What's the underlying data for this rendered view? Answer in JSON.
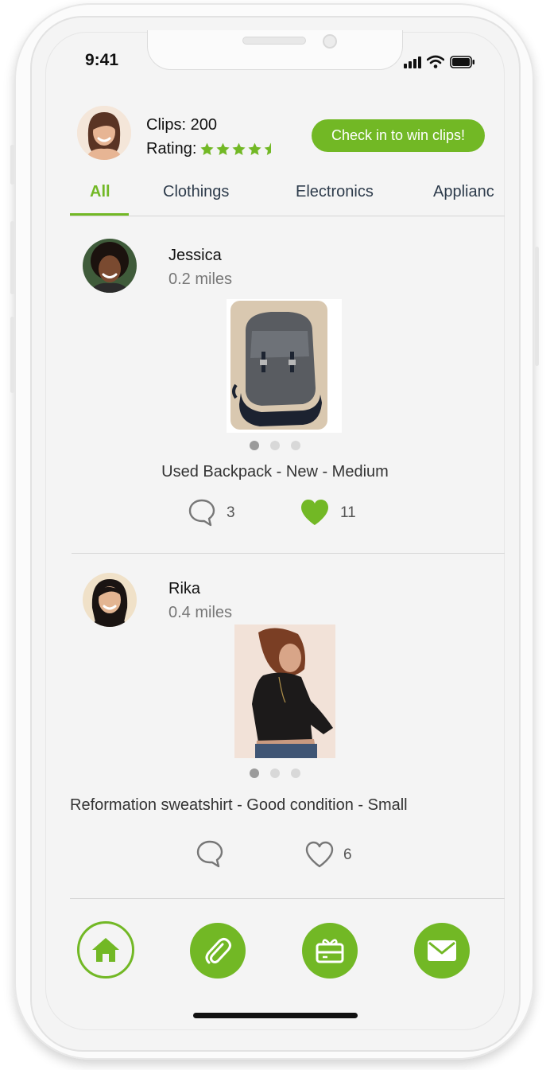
{
  "status_bar": {
    "time": "9:41"
  },
  "header": {
    "clips_label": "Clips: 200",
    "rating_label": "Rating:",
    "rating_stars": 4.5,
    "checkin_button": "Check in to win clips!"
  },
  "tabs": [
    {
      "label": "All",
      "active": true
    },
    {
      "label": "Clothings",
      "active": false
    },
    {
      "label": "Electronics",
      "active": false
    },
    {
      "label": "Applianc",
      "active": false
    }
  ],
  "posts": [
    {
      "user": "Jessica",
      "distance": "0.2 miles",
      "title": "Used Backpack - New - Medium",
      "comments": "3",
      "likes": "11",
      "liked": true,
      "image_slide": 1,
      "image_count": 3
    },
    {
      "user": "Rika",
      "distance": "0.4 miles",
      "title": "Reformation sweatshirt - Good condition - Small",
      "comments": "",
      "likes": "6",
      "liked": false,
      "image_slide": 1,
      "image_count": 3
    }
  ],
  "bottom_nav": [
    {
      "name": "home-icon",
      "active": true
    },
    {
      "name": "paperclip-icon",
      "active": false
    },
    {
      "name": "gift-card-icon",
      "active": false
    },
    {
      "name": "mail-icon",
      "active": false
    }
  ],
  "colors": {
    "accent": "#72b825",
    "text": "#111111",
    "muted": "#777777",
    "background": "#f4f4f4"
  }
}
